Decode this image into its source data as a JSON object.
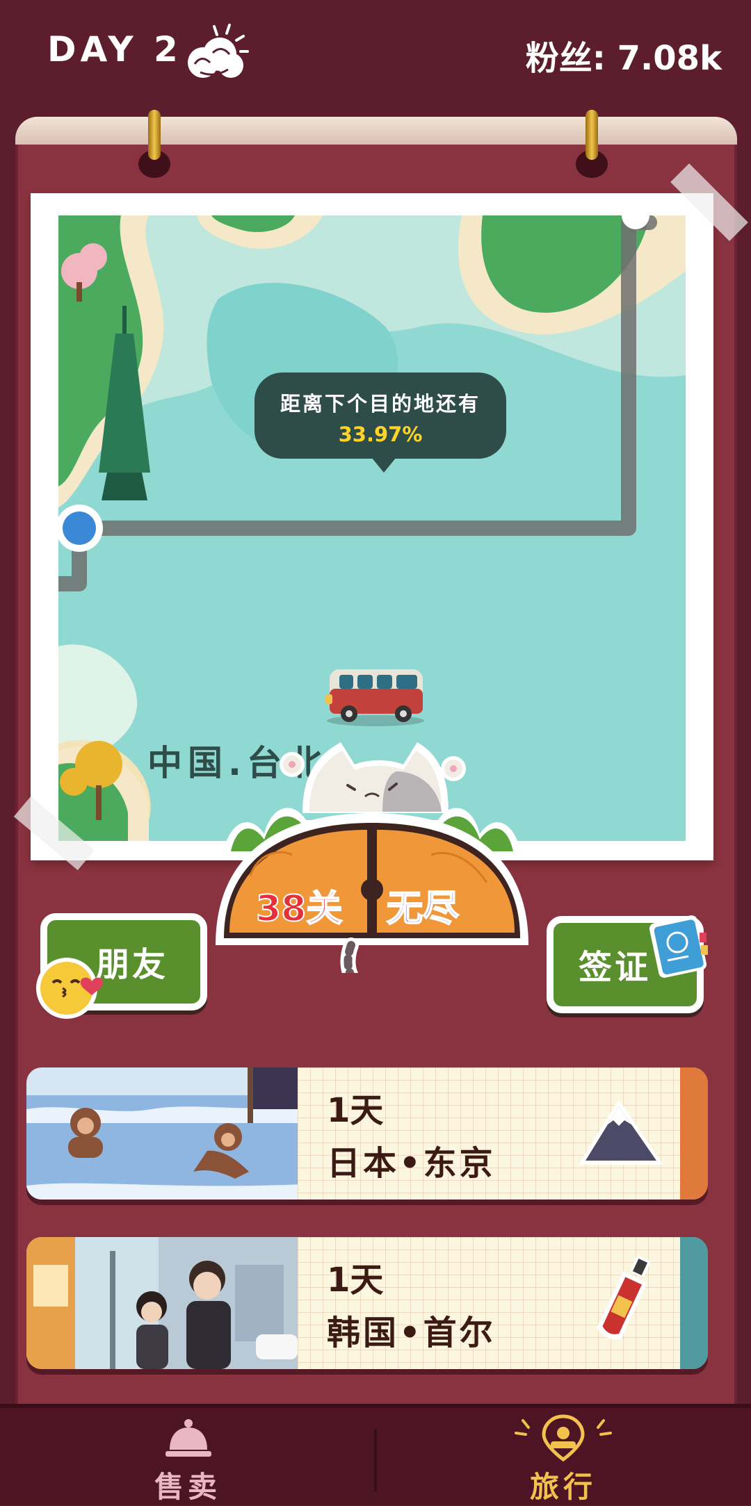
{
  "hud": {
    "day": "DAY 2",
    "fans_label": "粉丝:",
    "fans_value": "7.08k"
  },
  "map": {
    "bubble_text": "距离下个目的地还有",
    "progress_percent": "33.97%",
    "location": "中国.台北"
  },
  "mode": {
    "levels": "38关",
    "endless": "无尽"
  },
  "side_buttons": {
    "friends": "朋友",
    "visa": "签证"
  },
  "destinations": [
    {
      "days": "1天",
      "city": "日本•东京",
      "icon": "mountain-icon",
      "accent": "#e07a3c"
    },
    {
      "days": "1天",
      "city": "韩国•首尔",
      "icon": "hot-sauce-icon",
      "accent": "#4f9ba0"
    }
  ],
  "nav": {
    "sell": "售卖",
    "travel": "旅行"
  },
  "colors": {
    "background": "#5c1d2c",
    "book": "#8a3340",
    "map_water": "#8fd9d2",
    "progress_text": "#ffd327",
    "button_green": "#5a8f2e",
    "nav_active": "#f2c14e",
    "nav_inactive": "#e9b6c6",
    "levels_text": "#e5303a",
    "endless_text": "#5b3fd1"
  }
}
